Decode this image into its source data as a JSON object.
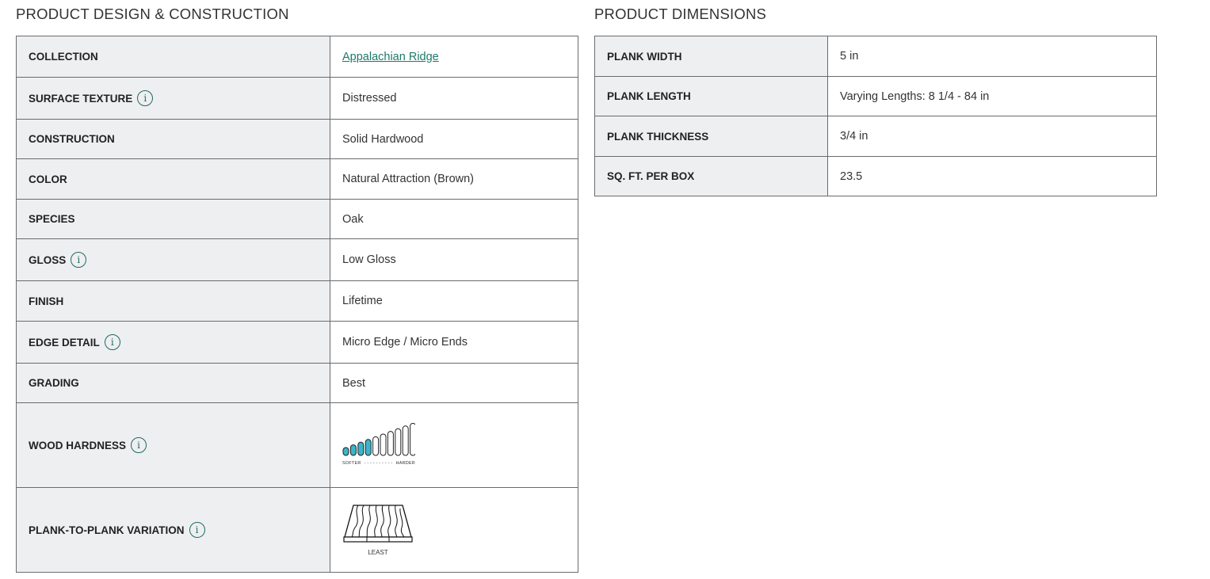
{
  "left_section": {
    "title": "PRODUCT DESIGN & CONSTRUCTION",
    "rows": [
      {
        "label": "COLLECTION",
        "value": "Appalachian Ridge"
      },
      {
        "label": "SURFACE TEXTURE",
        "value": "Distressed"
      },
      {
        "label": "CONSTRUCTION",
        "value": "Solid Hardwood"
      },
      {
        "label": "COLOR",
        "value": "Natural Attraction (Brown)"
      },
      {
        "label": "SPECIES",
        "value": "Oak"
      },
      {
        "label": "GLOSS",
        "value": "Low Gloss"
      },
      {
        "label": "FINISH",
        "value": "Lifetime"
      },
      {
        "label": "EDGE DETAIL",
        "value": "Micro Edge / Micro Ends"
      },
      {
        "label": "GRADING",
        "value": "Best"
      },
      {
        "label": "WOOD HARDNESS"
      },
      {
        "label": "PLANK-TO-PLANK VARIATION"
      }
    ],
    "hardness": {
      "softer": "SOFTER",
      "dashes": "- - - - - - - - - -",
      "harder": "HARDER",
      "level": 4,
      "of": 10
    },
    "variation": {
      "caption": "LEAST"
    },
    "info_icon_glyph": "i"
  },
  "right_section": {
    "title": "PRODUCT DIMENSIONS",
    "rows": [
      {
        "label": "PLANK WIDTH",
        "value": "5 in"
      },
      {
        "label": "PLANK LENGTH",
        "value": "Varying Lengths: 8 1/4 - 84 in"
      },
      {
        "label": "PLANK THICKNESS",
        "value": "3/4 in"
      },
      {
        "label": "SQ. FT. PER BOX",
        "value": "23.5"
      }
    ]
  },
  "colors": {
    "accent": "#1b7a6b",
    "hardness_fill": "#3bb6c8",
    "label_bg": "#eeeff0",
    "border": "#6b6b6b"
  }
}
